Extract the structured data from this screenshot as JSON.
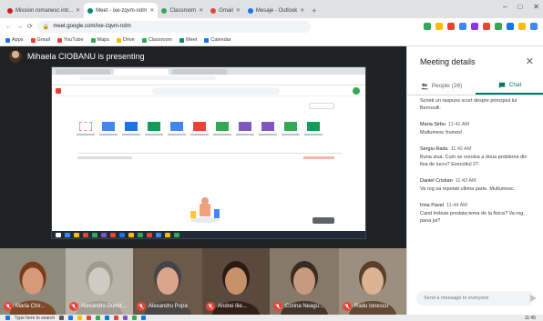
{
  "browser": {
    "tabs": [
      {
        "label": "Mission romanesc intr...",
        "color": "#c5221f",
        "active": false
      },
      {
        "label": "Meet - ixe-zqvm-ndm",
        "color": "#00897b",
        "active": true
      },
      {
        "label": "Classroom",
        "color": "#34a853",
        "active": false
      },
      {
        "label": "Gmail",
        "color": "#ea4335",
        "active": false
      },
      {
        "label": "Mesaje - Outlook",
        "color": "#1a73e8",
        "active": false
      }
    ],
    "url": "meet.google.com/ixe-zqvm-ndm",
    "window_controls": [
      "–",
      "□",
      "✕"
    ],
    "bookmarks": [
      "Apps",
      "Gmail",
      "YouTube",
      "Maps",
      "Drive",
      "Classroom",
      "Meet",
      "Calendar"
    ],
    "ext_colors": [
      "#34a853",
      "#fbbc05",
      "#ea4335",
      "#4285f4",
      "#9334e6",
      "#ea4335",
      "#34a853",
      "#1a73e8",
      "#fbbc05",
      "#4285f4"
    ]
  },
  "meet": {
    "presenter_text": "Mihaela CIOBANU is presenting",
    "participants": [
      {
        "name": "Maria Chir...",
        "bg": "#8f8a7c",
        "face": "#d59a7a",
        "hair": "#7a3b1c"
      },
      {
        "name": "Alexandra Dumit...",
        "bg": "#b9b3a7",
        "face": "#cfcac4",
        "hair": "#9f9a92"
      },
      {
        "name": "Alexandru Popa",
        "bg": "#6b5a4a",
        "face": "#d9a68b",
        "hair": "#444"
      },
      {
        "name": "Andrei Ilie...",
        "bg": "#5a4a3e",
        "face": "#c7916b",
        "hair": "#2b1a12"
      },
      {
        "name": "Corina Neagu...",
        "bg": "#87796a",
        "face": "#c59a7f",
        "hair": "#3a2a20"
      },
      {
        "name": "Radu Ionescu",
        "bg": "#9c8f80",
        "face": "#d9b394",
        "hair": "#5a3e28"
      }
    ]
  },
  "panel": {
    "title": "Meeting details",
    "close_icon": "close-icon",
    "tabs": [
      {
        "label": "People (26)",
        "active": false
      },
      {
        "label": "Chat",
        "active": true
      }
    ],
    "messages": [
      {
        "who": "",
        "time": "",
        "text": "Scrieti un raspuns scurt despre principiul lui Bernoulli."
      },
      {
        "who": "Maria Sirbu",
        "time": "11:41 AM",
        "text": "Multumesc frumos!"
      },
      {
        "who": "Sergiu Radu",
        "time": "11:42 AM",
        "text": "Buna ziua. Cum se rezolva a doua problema din fisa de lucru? Exercitiul 27."
      },
      {
        "who": "Daniel Cristian",
        "time": "11:43 AM",
        "text": "Va rog sa repetati ultima parte. Multumesc."
      },
      {
        "who": "Irina Pavel",
        "time": "11:44 AM",
        "text": "Cand trebuie predata tema de la fizica? Va rog, pana joi?"
      }
    ],
    "input_placeholder": "Send a message to everyone"
  },
  "taskbar": {
    "labels": [
      "Type here to search",
      "11:45"
    ]
  }
}
